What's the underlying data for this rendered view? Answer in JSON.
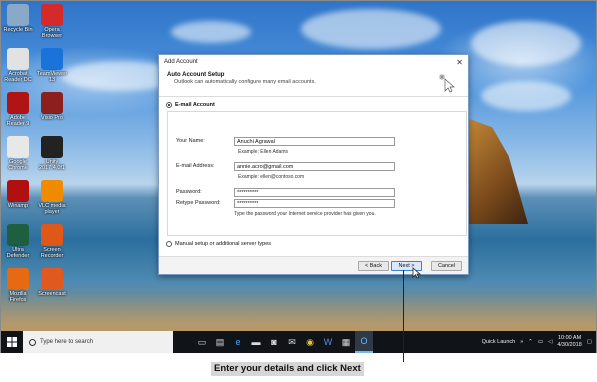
{
  "desktop": {
    "icons": [
      {
        "label": "Recycle Bin",
        "icon": "recycle-bin-icon",
        "color": "#8aa9c8"
      },
      {
        "label": "Opera Browser",
        "icon": "opera-icon",
        "color": "#d42a2a"
      },
      {
        "label": "Acrobat Reader DC",
        "icon": "acrobat-icon",
        "color": "#e2e2e2"
      },
      {
        "label": "TeamViewer 13",
        "icon": "teamviewer-icon",
        "color": "#1a73d9"
      },
      {
        "label": "Adobe Reader 9",
        "icon": "adobe-reader-icon",
        "color": "#b11414"
      },
      {
        "label": "Visio Pro",
        "icon": "ms-project-icon",
        "color": "#8e1f1f"
      },
      {
        "label": "Google Chrome",
        "icon": "chrome-icon",
        "color": "#e8e8e8"
      },
      {
        "label": "Unity 2017.4.0f1",
        "icon": "unity-icon",
        "color": "#222222"
      },
      {
        "label": "Winamp",
        "icon": "winamp-icon",
        "color": "#b01010"
      },
      {
        "label": "VLC media player",
        "icon": "vlc-icon",
        "color": "#f08a00"
      },
      {
        "label": "Ultra Defender",
        "icon": "ultra-icon",
        "color": "#1d5f3e"
      },
      {
        "label": "Screen Recorder",
        "icon": "screen-recorder-icon",
        "color": "#e0571a"
      },
      {
        "label": "Mozilla Firefox",
        "icon": "firefox-icon",
        "color": "#e66a12"
      },
      {
        "label": "Screencast",
        "icon": "screencast-icon",
        "color": "#e05a20"
      }
    ]
  },
  "dialog": {
    "title": "Add Account",
    "close_glyph": "✕",
    "header_title": "Auto Account Setup",
    "header_subtitle": "Outlook can automatically configure many email accounts.",
    "email_option": "E-mail Account",
    "manual_option": "Manual setup or additional server types",
    "fields": {
      "name_label": "Your Name:",
      "name_value": "Anuchi Agrawal",
      "name_example": "Example: Ellen Adams",
      "email_label": "E-mail Address:",
      "email_value": "annie.acro@gmail.com",
      "email_example": "Example: ellen@contoso.com",
      "password_label": "Password:",
      "password_value": "**********",
      "retype_label": "Retype Password:",
      "retype_value": "**********",
      "password_hint": "Type the password your Internet service provider has given you."
    },
    "buttons": {
      "back": "< Back",
      "next": "Next >",
      "cancel": "Cancel"
    }
  },
  "taskbar": {
    "search_placeholder": "Type here to search",
    "quick_launch": "Quick Launch",
    "time": "10:00 AM",
    "date": "4/30/2018",
    "apps": [
      "task-view-icon",
      "file-explorer-icon",
      "edge-icon",
      "folder-icon",
      "store-icon",
      "mail-icon",
      "chrome-icon",
      "word-icon",
      "excel-icon",
      "outlook-icon"
    ]
  },
  "caption": "Enter your details and click Next"
}
